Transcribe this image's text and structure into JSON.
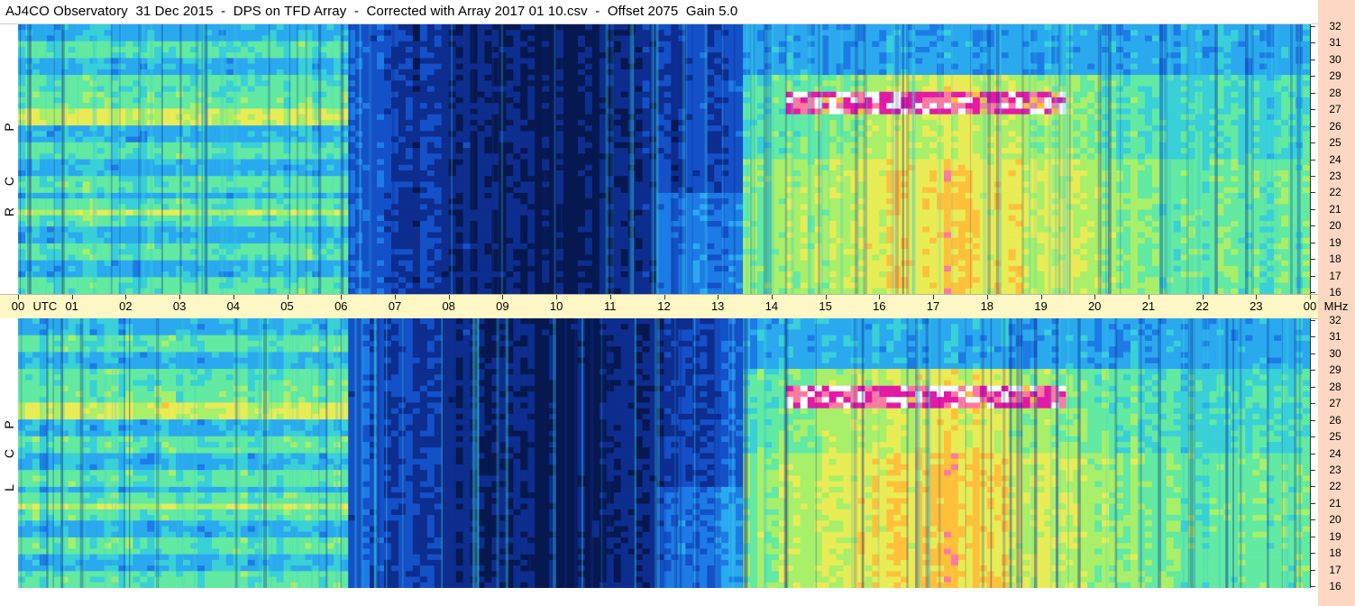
{
  "title": "AJ4CO Observatory  31 Dec 2015  -  DPS on TFD Array  -  Corrected with Array 2017 01 10.csv  -  Offset 2075  Gain 5.0",
  "time_axis": {
    "labels": [
      "00",
      "UTC",
      "01",
      "02",
      "03",
      "04",
      "05",
      "06",
      "07",
      "08",
      "09",
      "10",
      "11",
      "12",
      "13",
      "14",
      "15",
      "16",
      "17",
      "18",
      "19",
      "20",
      "21",
      "22",
      "23",
      "00",
      "MHz"
    ],
    "hours": [
      0,
      1,
      2,
      3,
      4,
      5,
      6,
      7,
      8,
      9,
      10,
      11,
      12,
      13,
      14,
      15,
      16,
      17,
      18,
      19,
      20,
      21,
      22,
      23,
      24
    ]
  },
  "colors": {
    "axis_band": "#fff8c6",
    "freq_column": "#fcd8c2",
    "colormap": [
      "#071850",
      "#0d2d8f",
      "#1450c8",
      "#1d7be6",
      "#2aa9ef",
      "#39d0d8",
      "#62e9a2",
      "#a8ef6a",
      "#e8ec55",
      "#ffc13a",
      "#ff7aa0",
      "#e31aa6",
      "#ffffff"
    ]
  },
  "chart_data": [
    {
      "type": "heatmap",
      "panel": "RCP",
      "side_label": [
        "R",
        "C",
        "P"
      ],
      "x_unit": "UTC hour",
      "y_unit": "MHz",
      "xlim": [
        0,
        24
      ],
      "ylim": [
        16,
        32
      ],
      "y_ticks": [
        32,
        31,
        30,
        29,
        28,
        27,
        26,
        25,
        24,
        23,
        22,
        21,
        20,
        19,
        18,
        17,
        16
      ],
      "night_dark_region_hours": [
        6.2,
        13.5
      ],
      "bright_band_mhz": [
        26.5,
        28
      ],
      "bright_band_hours": [
        14.2,
        19.5
      ],
      "solar_cone_center_hour": 17.3
    },
    {
      "type": "heatmap",
      "panel": "LCP",
      "side_label": [
        "L",
        "C",
        "P"
      ],
      "x_unit": "UTC hour",
      "y_unit": "MHz",
      "xlim": [
        0,
        24
      ],
      "ylim": [
        16,
        32
      ],
      "y_ticks": [
        32,
        31,
        30,
        29,
        28,
        27,
        26,
        25,
        24,
        23,
        22,
        21,
        20,
        19,
        18,
        17,
        16
      ],
      "night_dark_region_hours": [
        6.2,
        13.5
      ],
      "bright_band_mhz": [
        26.5,
        28
      ],
      "bright_band_hours": [
        14.2,
        19.5
      ],
      "solar_cone_center_hour": 17.3
    }
  ]
}
